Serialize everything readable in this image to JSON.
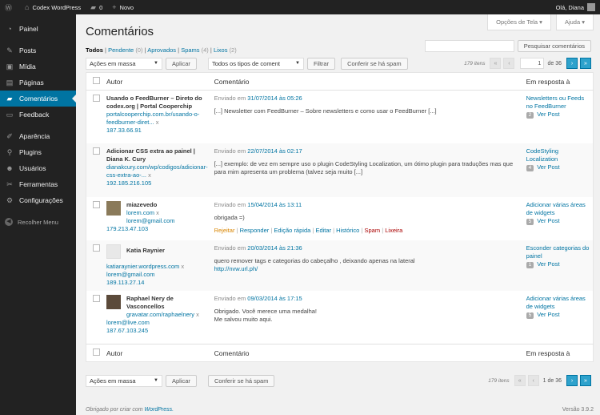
{
  "adminbar": {
    "site": "Codex WordPress",
    "comments_count": "0",
    "new_label": "Novo",
    "greeting": "Olá, Diana"
  },
  "sidebar": {
    "items": [
      {
        "label": "Painel",
        "icon": "dashboard-icon"
      },
      {
        "label": "Posts",
        "icon": "pin-icon"
      },
      {
        "label": "Mídia",
        "icon": "media-icon"
      },
      {
        "label": "Páginas",
        "icon": "pages-icon"
      },
      {
        "label": "Comentários",
        "icon": "comments-icon"
      },
      {
        "label": "Feedback",
        "icon": "feedback-icon"
      },
      {
        "label": "Aparência",
        "icon": "brush-icon"
      },
      {
        "label": "Plugins",
        "icon": "plugin-icon"
      },
      {
        "label": "Usuários",
        "icon": "users-icon"
      },
      {
        "label": "Ferramentas",
        "icon": "tools-icon"
      },
      {
        "label": "Configurações",
        "icon": "settings-icon"
      }
    ],
    "collapse_label": "Recolher Menu"
  },
  "screen_options": "Opções de Tela",
  "help": "Ajuda",
  "title": "Comentários",
  "filters": {
    "all": "Todos",
    "pending": "Pendente",
    "pending_count": "(0)",
    "approved": "Aprovados",
    "spam": "Spams",
    "spam_count": "(4)",
    "trash": "Lixos",
    "trash_count": "(2)",
    "sep": "|"
  },
  "search": {
    "button": "Pesquisar comentários"
  },
  "tablenav": {
    "bulk": "Ações em massa",
    "apply": "Aplicar",
    "type": "Todos os tipos de coment",
    "filter": "Filtrar",
    "check_spam": "Conferir se há spam",
    "items": "179 itens",
    "page": "1",
    "of": "de 36",
    "of_bottom": "1 de 36"
  },
  "columns": {
    "author": "Autor",
    "comment": "Comentário",
    "response": "Em resposta à"
  },
  "comments": [
    {
      "author": "Usando o FeedBurner – Direto do codex.org | Portal Cooperchip",
      "url": "portalcooperchip.com.br/usando-o-feedburner-diret...",
      "ip": "187.33.66.91",
      "date": "31/07/2014 às 05:26",
      "text": "[...] Newsletter com FeedBurner – Sobre newsletters e como usar o FeedBurner [...]",
      "post": "Newsletters ou Feeds no FeedBurner",
      "count": "2"
    },
    {
      "author": "Adicionar CSS extra ao painel | Diana K. Cury",
      "url": "dianakcury.com/wp/codigos/adicionar-css-extra-ao-...",
      "ip": "192.185.216.105",
      "date": "22/07/2014 às 02:17",
      "text": "[...] exemplo: de vez em sempre uso o plugin CodeStyling Localization, um ótimo plugin para traduções mas que para mim apresenta um problema (talvez seja muito [...]",
      "post": "CodeStyling Localization",
      "count": "4"
    },
    {
      "author": "miazevedo",
      "url": "lorem.com",
      "email": "lorem@gmail.com",
      "ip": "179.213.47.103",
      "date": "15/04/2014 às 13:11",
      "text": "obrigada =)",
      "post": "Adicionar várias áreas de widgets",
      "count": "5",
      "actions": {
        "unapprove": "Rejeitar",
        "reply": "Responder",
        "quick": "Edição rápida",
        "edit": "Editar",
        "history": "Histórico",
        "spam": "Spam",
        "trash": "Lixeira"
      }
    },
    {
      "author": "Katia Raynier",
      "url": "katiaraynier.wordpress.com",
      "email": "lorem@gmail.com",
      "ip": "189.113.27.14",
      "date": "20/03/2014 às 21:36",
      "text": "quero remover tags e categorias do cabeçalho , deixando apenas na lateral",
      "link": "http://nvw.url.ph/",
      "post": "Esconder categorias do painel",
      "count": "1"
    },
    {
      "author": "Raphael Nery de Vasconcellos",
      "url": "gravatar.com/raphaelnery",
      "email": "lorem@live.com",
      "ip": "187.67.103.245",
      "date": "09/03/2014 às 17:15",
      "text": "Obrigado. Você merece uma medalha!",
      "text2": "Me salvou muito aqui.",
      "post": "Adicionar várias áreas de widgets",
      "count": "5"
    }
  ],
  "sent_label": "Enviado em",
  "view_post": "Ver Post",
  "x": "x",
  "footer": {
    "thanks": "Obrigado por criar com ",
    "wp": "WordPress.",
    "version": "Versão 3.9.2"
  }
}
